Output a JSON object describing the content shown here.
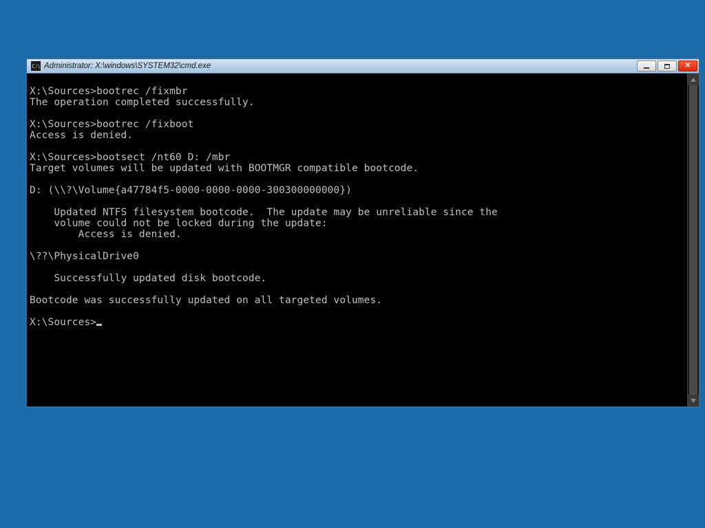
{
  "window": {
    "title": "Administrator: X:\\windows\\SYSTEM32\\cmd.exe",
    "icon_label": "C:\\"
  },
  "terminal": {
    "lines": [
      "",
      "X:\\Sources>bootrec /fixmbr",
      "The operation completed successfully.",
      "",
      "X:\\Sources>bootrec /fixboot",
      "Access is denied.",
      "",
      "X:\\Sources>bootsect /nt60 D: /mbr",
      "Target volumes will be updated with BOOTMGR compatible bootcode.",
      "",
      "D: (\\\\?\\Volume{a47784f5-0000-0000-0000-300300000000})",
      "",
      "    Updated NTFS filesystem bootcode.  The update may be unreliable since the",
      "    volume could not be locked during the update:",
      "        Access is denied.",
      "",
      "\\??\\PhysicalDrive0",
      "",
      "    Successfully updated disk bootcode.",
      "",
      "Bootcode was successfully updated on all targeted volumes.",
      ""
    ],
    "prompt": "X:\\Sources>"
  }
}
